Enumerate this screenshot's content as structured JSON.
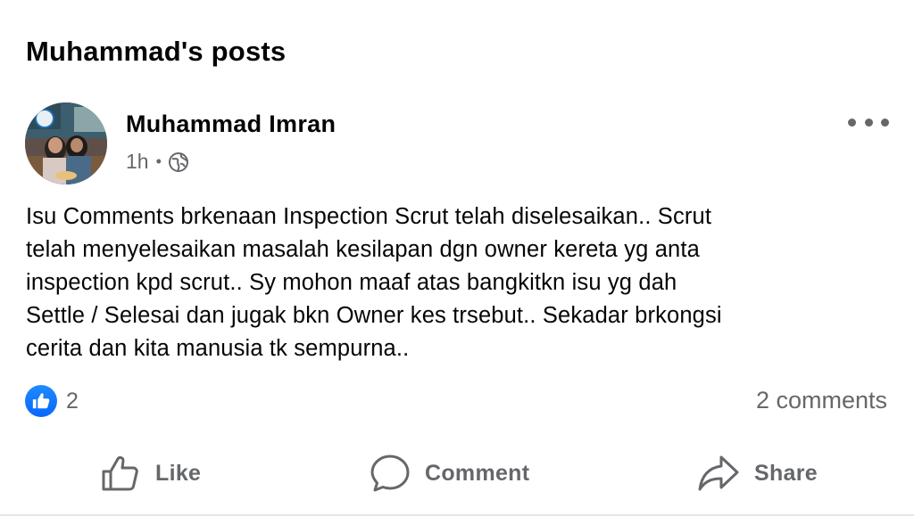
{
  "page": {
    "title": "Muhammad's posts"
  },
  "post": {
    "author": "Muhammad Imran",
    "time": "1h",
    "audience_icon": "globe-icon",
    "more_icon": "more-options-icon",
    "text_lines": [
      "Isu Comments brkenaan Inspection Scrut telah diselesaikan.. Scrut",
      "telah menyelesaikan masalah kesilapan dgn owner kereta yg anta",
      "inspection kpd scrut.. Sy mohon maaf atas bangkitkn isu yg dah",
      "Settle / Selesai dan jugak bkn Owner kes trsebut.. Sekadar brkongsi",
      "cerita dan kita manusia tk sempurna.."
    ],
    "reaction_icon": "like-reaction-icon",
    "reaction_count": "2",
    "comments_count": "2 comments"
  },
  "actions": {
    "like_label": "Like",
    "comment_label": "Comment",
    "share_label": "Share"
  },
  "colors": {
    "accent": "#0866ff",
    "secondary_text": "#65676b",
    "primary_text": "#050505"
  }
}
